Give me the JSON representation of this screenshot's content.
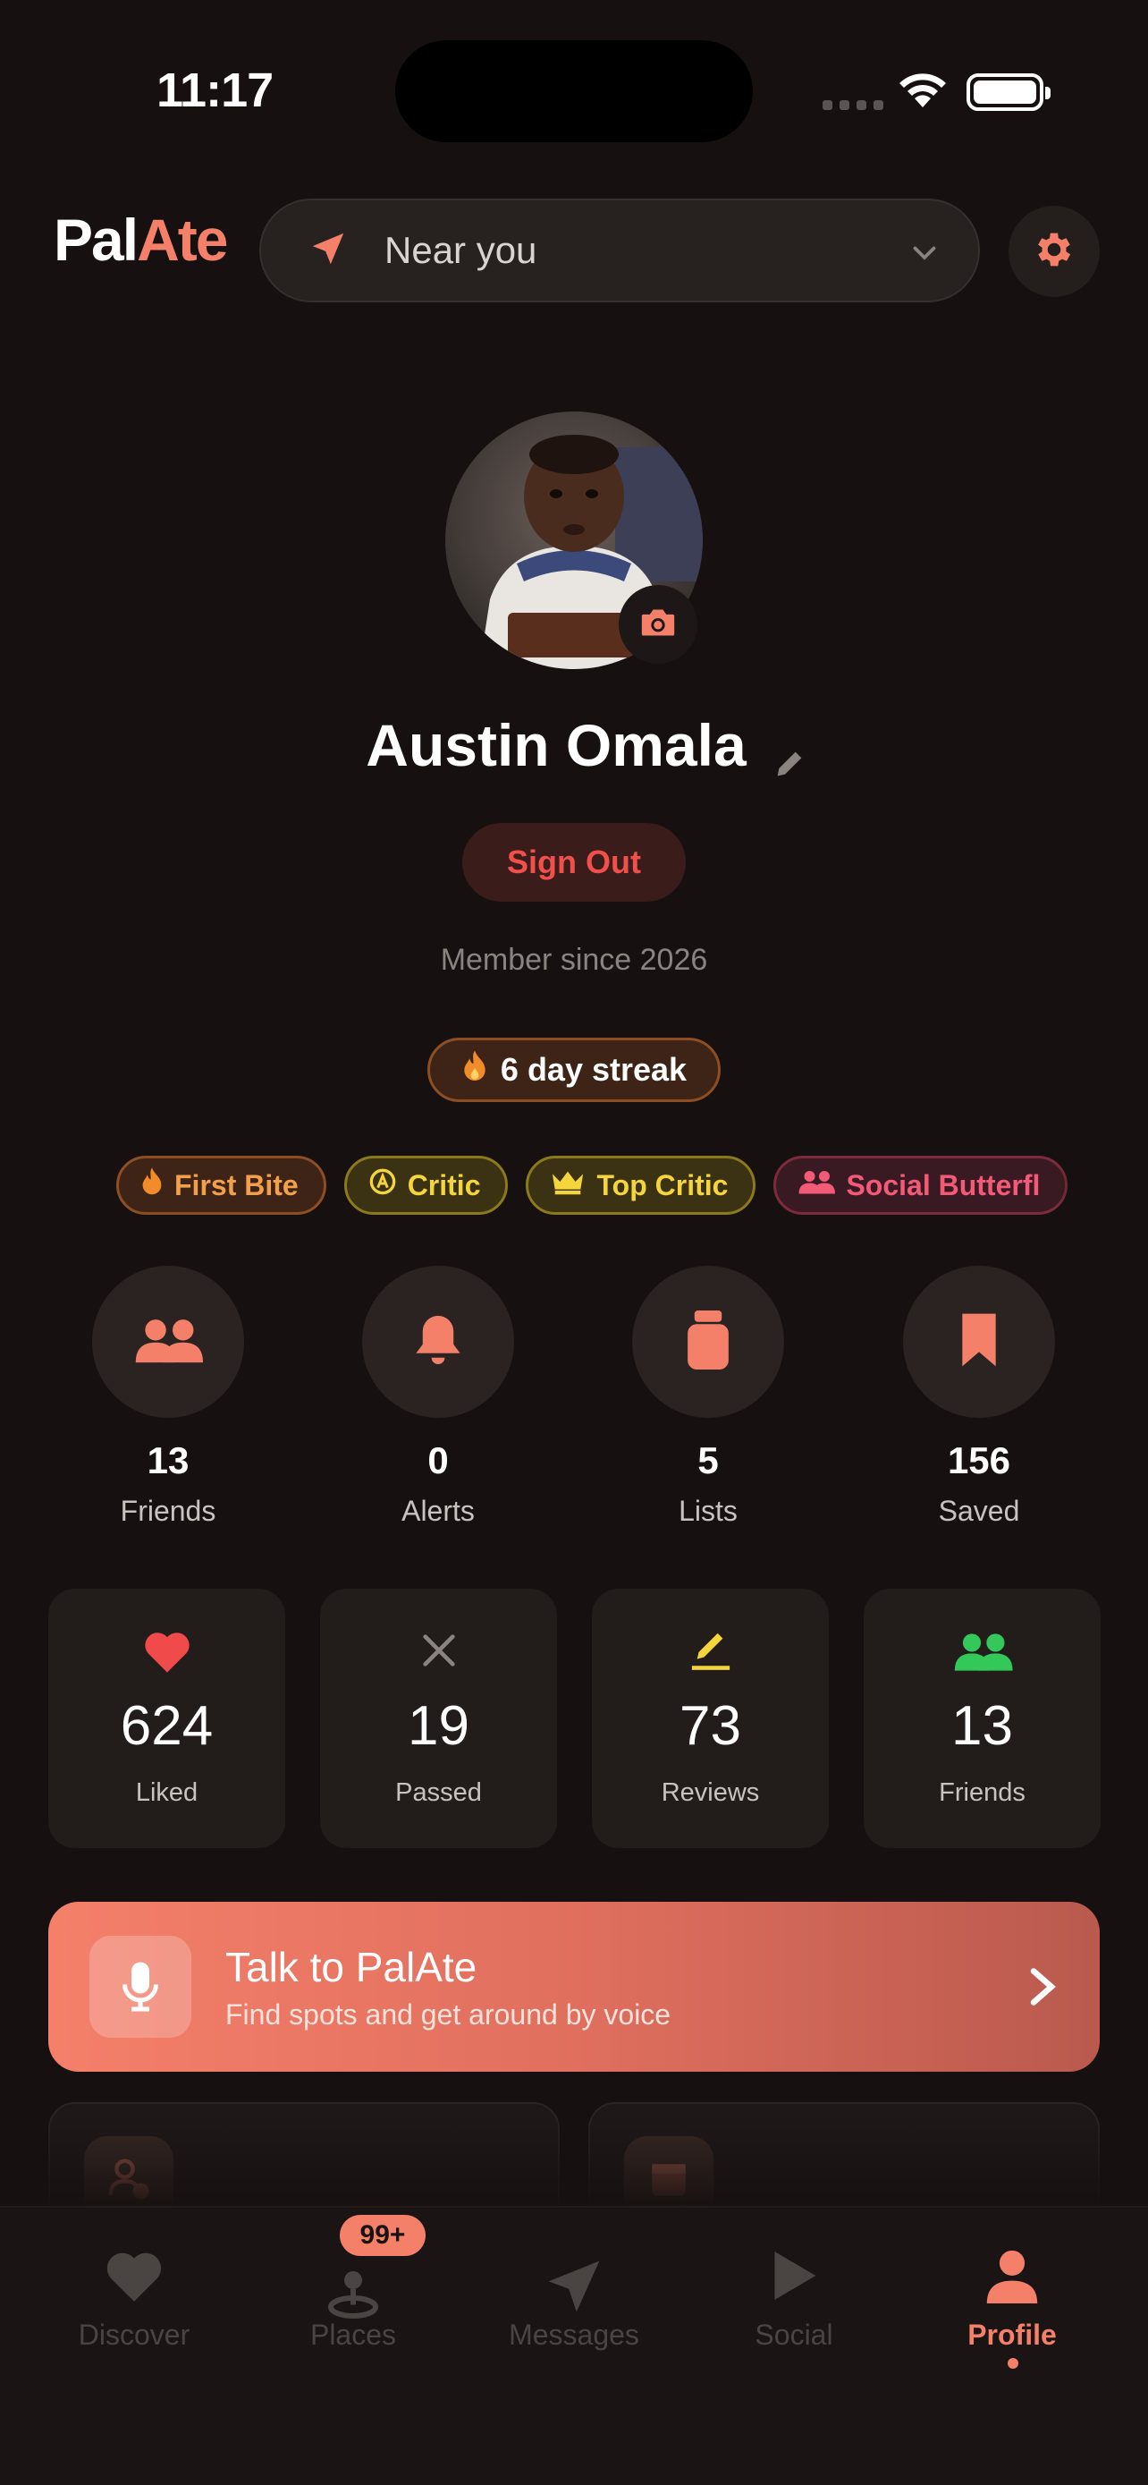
{
  "status_bar": {
    "time": "11:17"
  },
  "header": {
    "logo_part1": "Pal",
    "logo_part2": "Ate",
    "location_label": "Near you",
    "accent_color": "#f4806a"
  },
  "profile": {
    "name": "Austin Omala",
    "sign_out_label": "Sign Out",
    "member_since": "Member since 2026",
    "streak_label": "6 day streak"
  },
  "badges": [
    {
      "label": "First Bite",
      "icon": "flame-icon"
    },
    {
      "label": "Critic",
      "icon": "critic-icon"
    },
    {
      "label": "Top Critic",
      "icon": "crown-icon"
    },
    {
      "label": "Social Butterfl",
      "icon": "people-icon"
    }
  ],
  "quick_stats": [
    {
      "value": "13",
      "label": "Friends",
      "icon": "people-icon"
    },
    {
      "value": "0",
      "label": "Alerts",
      "icon": "bell-icon"
    },
    {
      "value": "5",
      "label": "Lists",
      "icon": "jar-icon"
    },
    {
      "value": "156",
      "label": "Saved",
      "icon": "bookmark-icon"
    }
  ],
  "stat_cards": [
    {
      "value": "624",
      "label": "Liked",
      "icon": "heart-icon",
      "color": "#f04a4a"
    },
    {
      "value": "19",
      "label": "Passed",
      "icon": "x-icon",
      "color": "#8a8380"
    },
    {
      "value": "73",
      "label": "Reviews",
      "icon": "pencil-icon",
      "color": "#f4d53c"
    },
    {
      "value": "13",
      "label": "Friends",
      "icon": "people-icon",
      "color": "#34c759"
    }
  ],
  "talk_banner": {
    "title": "Talk to PalAte",
    "subtitle": "Find spots and get around by voice"
  },
  "tabs": [
    {
      "label": "Discover",
      "icon": "heart-icon"
    },
    {
      "label": "Places",
      "icon": "pin-icon",
      "badge": "99+"
    },
    {
      "label": "Messages",
      "icon": "paper-plane-icon"
    },
    {
      "label": "Social",
      "icon": "play-icon"
    },
    {
      "label": "Profile",
      "icon": "person-icon",
      "active": true
    }
  ]
}
